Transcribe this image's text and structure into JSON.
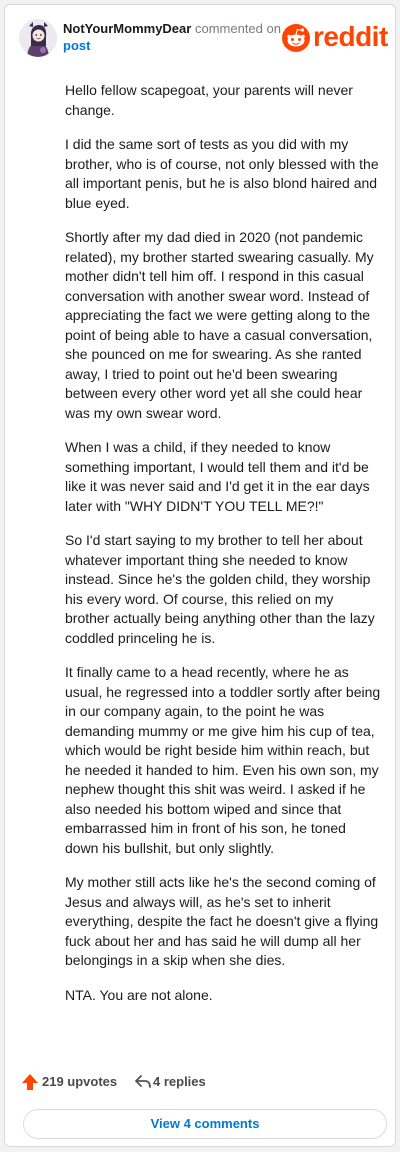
{
  "comment": {
    "username": "NotYourMommyDear",
    "action_text": "commented on",
    "post_link": "post",
    "paragraphs": [
      "Hello fellow scapegoat, your parents will never change.",
      "I did the same sort of tests as you did with my brother, who is of course, not only blessed with the all important penis, but he is also blond haired and blue eyed.",
      "Shortly after my dad died in 2020 (not pandemic related), my brother started swearing casually. My mother didn't tell him off. I respond in this casual conversation with another swear word. Instead of appreciating the fact we were getting along to the point of being able to have a casual conversation, she pounced on me for swearing. As she ranted away, I tried to point out he'd been swearing between every other word yet all she could hear was my own swear word.",
      "When I was a child, if they needed to know something important, I would tell them and it'd be like it was never said and I'd get it in the ear days later with \"WHY DIDN'T YOU TELL ME?!\"",
      "So I'd start saying to my brother to tell her about whatever important thing she needed to know instead. Since he's the golden child, they worship his every word. Of course, this relied on my brother actually being anything other than the lazy coddled princeling he is.",
      "It finally came to a head recently, where he as usual, he regressed into a toddler sortly after being in our company again, to the point he was demanding mummy or me give him his cup of tea, which would be right beside him within reach, but he needed it handed to him. Even his own son, my nephew thought this shit was weird. I asked if he also needed his bottom wiped and since that embarrassed him in front of his son, he toned down his bullshit, but only slightly.",
      "My mother still acts like he's the second coming of Jesus and always will, as he's set to inherit everything, despite the fact he doesn't give a flying fuck about her and has said he will dump all her belongings in a skip when she dies.",
      "NTA. You are not alone."
    ],
    "upvotes": "219 upvotes",
    "replies": "4 replies",
    "view_comments": "View 4 comments"
  },
  "brand": {
    "logo_text": "reddit",
    "accent": "#ff4500",
    "link_color": "#0079d3"
  },
  "icons": {
    "avatar": "avatar",
    "logo": "reddit-snoo-icon",
    "upvote": "upvote-arrow-icon",
    "reply": "reply-arrow-icon"
  }
}
